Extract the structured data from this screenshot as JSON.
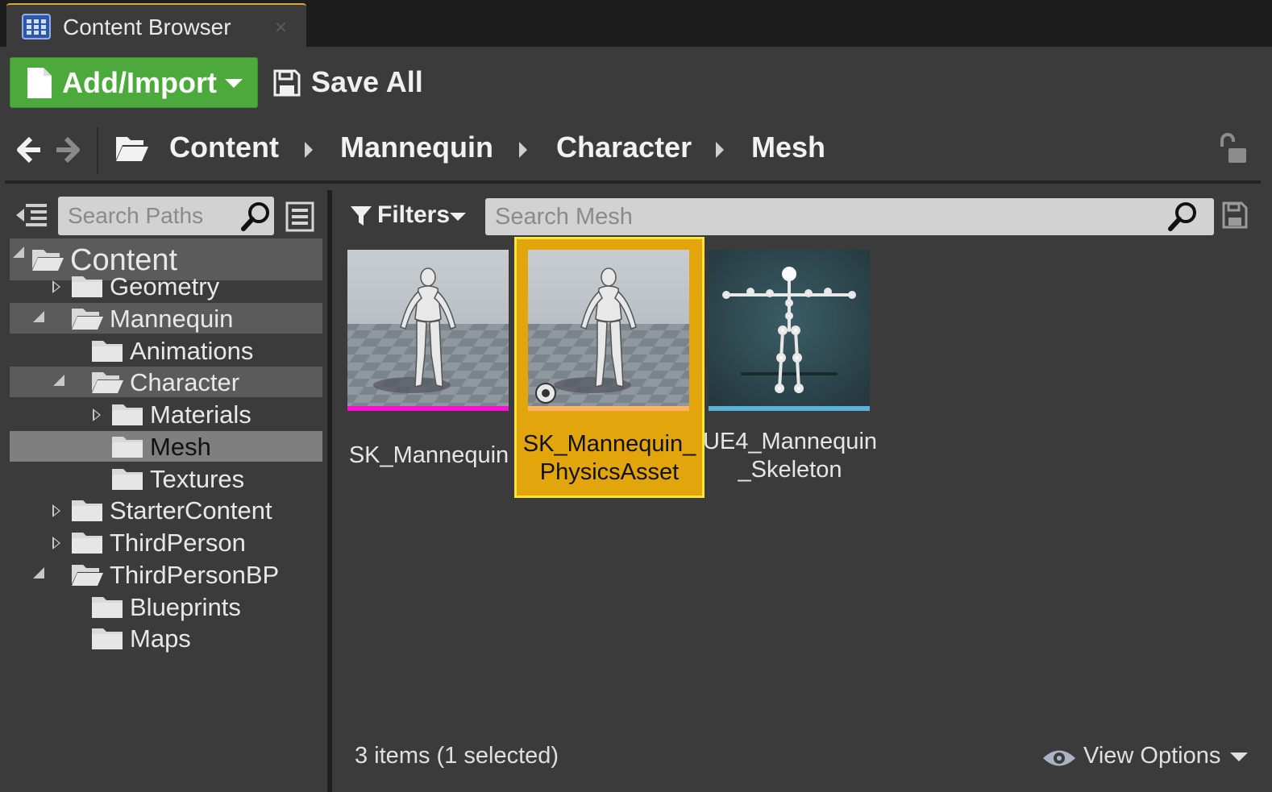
{
  "tab": {
    "title": "Content Browser",
    "icon": "content-browser-grid-icon",
    "close_icon": "close-icon"
  },
  "toolbar": {
    "add_import_label": "Add/Import",
    "save_all_label": "Save All"
  },
  "path": {
    "crumbs": [
      "Content",
      "Mannequin",
      "Character",
      "Mesh"
    ],
    "back_icon": "arrow-left-icon",
    "forward_icon": "arrow-right-icon",
    "lock_icon": "unlock-icon"
  },
  "sources": {
    "search_placeholder": "Search Paths",
    "tree": [
      {
        "label": "Content",
        "depth": 0,
        "expanded": true,
        "state": "selected"
      },
      {
        "label": "Geometry",
        "depth": 1,
        "expanded": false,
        "state": ""
      },
      {
        "label": "Mannequin",
        "depth": 1,
        "expanded": true,
        "state": "selected"
      },
      {
        "label": "Animations",
        "depth": 2,
        "expanded": null,
        "state": ""
      },
      {
        "label": "Character",
        "depth": 2,
        "expanded": true,
        "state": "selected"
      },
      {
        "label": "Materials",
        "depth": 3,
        "expanded": false,
        "state": ""
      },
      {
        "label": "Mesh",
        "depth": 3,
        "expanded": null,
        "state": "current"
      },
      {
        "label": "Textures",
        "depth": 3,
        "expanded": null,
        "state": ""
      },
      {
        "label": "StarterContent",
        "depth": 1,
        "expanded": false,
        "state": ""
      },
      {
        "label": "ThirdPerson",
        "depth": 1,
        "expanded": false,
        "state": ""
      },
      {
        "label": "ThirdPersonBP",
        "depth": 1,
        "expanded": true,
        "state": ""
      },
      {
        "label": "Blueprints",
        "depth": 2,
        "expanded": null,
        "state": ""
      },
      {
        "label": "Maps",
        "depth": 2,
        "expanded": null,
        "state": ""
      }
    ]
  },
  "assets_panel": {
    "filters_label": "Filters",
    "search_placeholder": "Search Mesh",
    "items": [
      {
        "name_line1": "SK_Mannequin",
        "name_line2": "",
        "type_color": "#ff10d0",
        "selected": false,
        "thumb": "mannequin"
      },
      {
        "name_line1": "SK_Mannequin_",
        "name_line2": "PhysicsAsset",
        "type_color": "#ffb060",
        "selected": true,
        "thumb": "mannequin"
      },
      {
        "name_line1": "UE4_Mannequin",
        "name_line2": "_Skeleton",
        "type_color": "#5ab3d6",
        "selected": false,
        "thumb": "skeleton"
      }
    ],
    "status": "3 items (1 selected)",
    "view_options_label": "View Options"
  },
  "colors": {
    "accent_green": "#4caa3c",
    "selection": "#e2a60c",
    "selection_border": "#ffe23a"
  }
}
